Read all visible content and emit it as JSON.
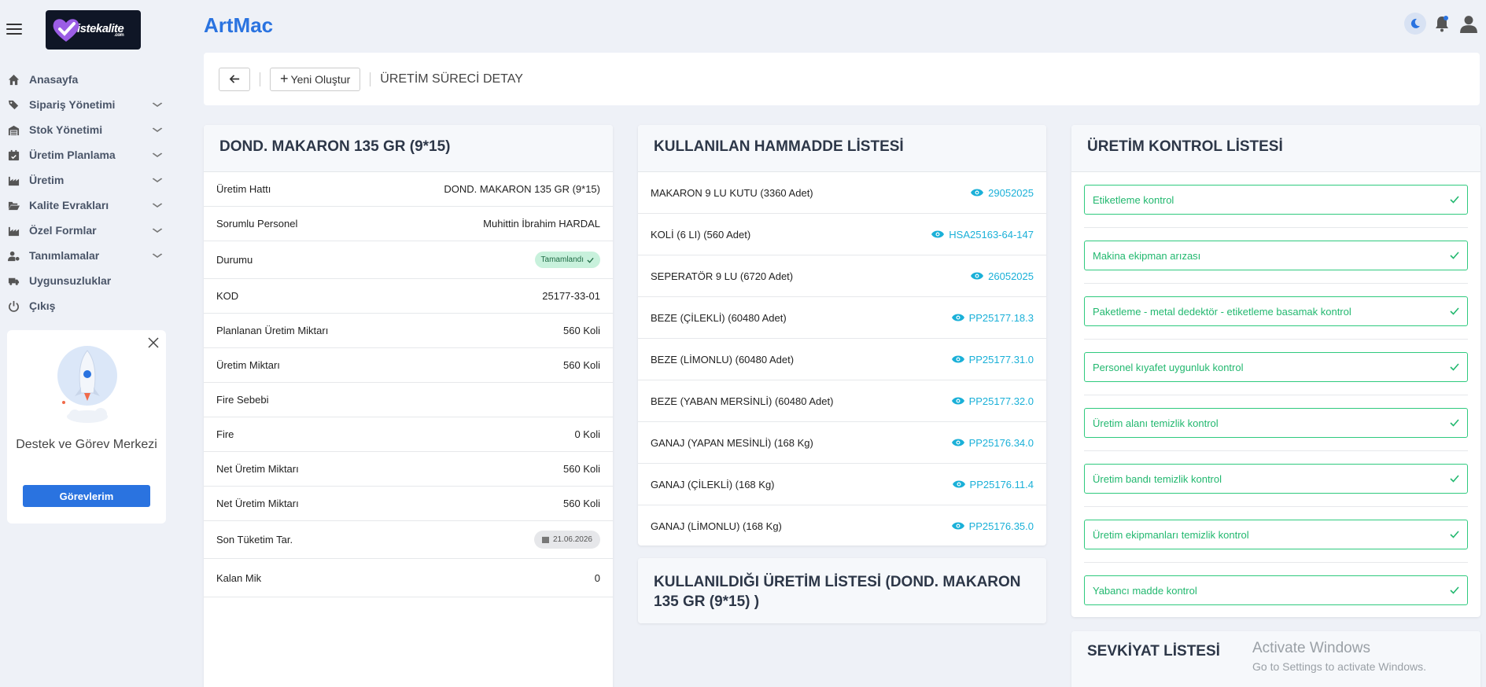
{
  "app": {
    "title": "ArtMac",
    "logo_text": "istekalite",
    "logo_sub": ".com"
  },
  "sidebar": {
    "items": [
      {
        "label": "Anasayfa",
        "icon": "home-icon",
        "has_children": false
      },
      {
        "label": "Sipariş Yönetimi",
        "icon": "tags-icon",
        "has_children": true
      },
      {
        "label": "Stok Yönetimi",
        "icon": "warehouse-icon",
        "has_children": true
      },
      {
        "label": "Üretim Planlama",
        "icon": "calendar-check-icon",
        "has_children": true
      },
      {
        "label": "Üretim",
        "icon": "industry-icon",
        "has_children": true
      },
      {
        "label": "Kalite Evrakları",
        "icon": "folder-open-icon",
        "has_children": true
      },
      {
        "label": "Özel Formlar",
        "icon": "industry-icon",
        "has_children": true
      },
      {
        "label": "Tanımlamalar",
        "icon": "user-gear-icon",
        "has_children": true
      },
      {
        "label": "Uygunsuzluklar",
        "icon": "truck-ramp-icon",
        "has_children": false
      },
      {
        "label": "Çıkış",
        "icon": "power-icon",
        "has_children": false
      }
    ]
  },
  "support": {
    "title": "Destek ve Görev Merkezi",
    "button": "Görevlerim"
  },
  "toolbar": {
    "new_label": "Yeni Oluştur",
    "breadcrumb": "ÜRETİM SÜRECİ DETAY"
  },
  "detail": {
    "title": "DOND. MAKARON 135 GR (9*15)",
    "rows": [
      {
        "label": "Üretim Hattı",
        "value": "DOND. MAKARON 135 GR (9*15)"
      },
      {
        "label": "Sorumlu Personel",
        "value": "Muhittin İbrahim HARDAL"
      },
      {
        "label": "Durumu",
        "value": "Tamamlandı"
      },
      {
        "label": "KOD",
        "value": "25177-33-01"
      },
      {
        "label": "Planlanan Üretim Miktarı",
        "value": "560 Koli"
      },
      {
        "label": "Üretim Miktarı",
        "value": "560 Koli"
      },
      {
        "label": "Fire Sebebi",
        "value": ""
      },
      {
        "label": "Fire",
        "value": "0 Koli"
      },
      {
        "label": "Net Üretim Miktarı",
        "value": "560 Koli"
      },
      {
        "label": "Net Üretim Miktarı",
        "value": "560 Koli"
      },
      {
        "label": "Son Tüketim Tar.",
        "value": "21.06.2026"
      },
      {
        "label": "Kalan Mik",
        "value": "0"
      }
    ]
  },
  "materials": {
    "title": "KULLANILAN HAMMADDE LİSTESİ",
    "rows": [
      {
        "name": "MAKARON 9 LU KUTU (3360 Adet)",
        "lot": "29052025"
      },
      {
        "name": "KOLİ (6 LI) (560 Adet)",
        "lot": "HSA25163-64-147"
      },
      {
        "name": "SEPERATÖR 9 LU (6720 Adet)",
        "lot": "26052025"
      },
      {
        "name": "BEZE (ÇİLEKLİ) (60480 Adet)",
        "lot": "PP25177.18.3"
      },
      {
        "name": "BEZE (LİMONLU) (60480 Adet)",
        "lot": "PP25177.31.0"
      },
      {
        "name": "BEZE (YABAN MERSİNLİ) (60480 Adet)",
        "lot": "PP25177.32.0"
      },
      {
        "name": "GANAJ (YAPAN MESİNLİ) (168 Kg)",
        "lot": "PP25176.34.0"
      },
      {
        "name": "GANAJ (ÇİLEKLİ) (168 Kg)",
        "lot": "PP25176.11.4"
      },
      {
        "name": "GANAJ (LİMONLU) (168 Kg)",
        "lot": "PP25176.35.0"
      }
    ]
  },
  "used_in": {
    "title": "KULLANILDIĞI ÜRETİM LİSTESİ (DOND. MAKARON 135 GR (9*15) )"
  },
  "controls": {
    "title": "ÜRETİM KONTROL LİSTESİ",
    "items": [
      "Etiketleme kontrol",
      "Makina ekipman arızası",
      "Paketleme - metal dedektör - etiketleme basamak kontrol",
      "Personel kıyafet uygunluk kontrol",
      "Üretim alanı temizlik kontrol",
      "Üretim bandı temizlik kontrol",
      "Üretim ekipmanları temizlik kontrol",
      "Yabancı madde kontrol"
    ]
  },
  "shipment": {
    "title": "SEVKİYAT LİSTESİ"
  },
  "watermark": {
    "line1": "Activate Windows",
    "line2": "Go to Settings to activate Windows."
  },
  "colors": {
    "accent": "#2a73e0",
    "link": "#1ab0d8",
    "success": "#22b86f",
    "badge_bg": "#c8f1dc"
  }
}
